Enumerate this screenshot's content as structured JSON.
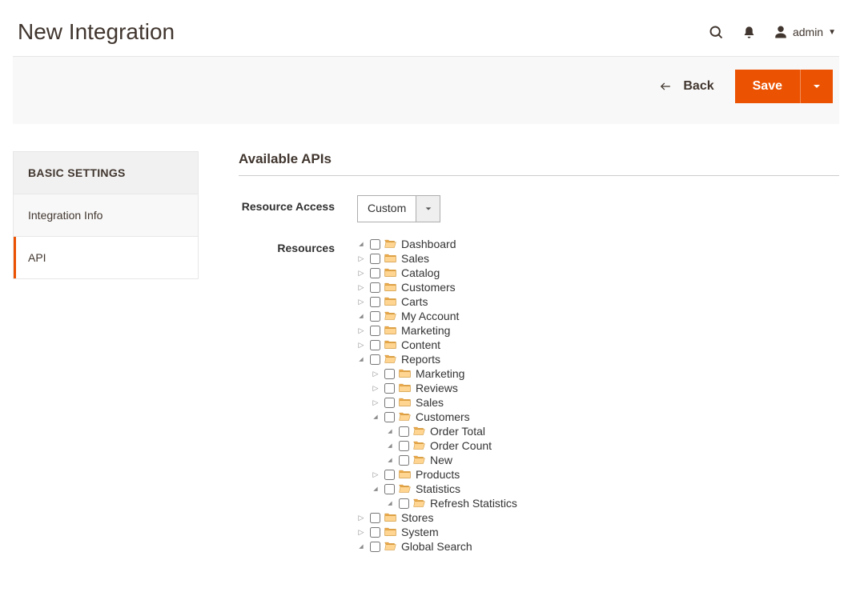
{
  "header": {
    "title": "New Integration",
    "username": "admin"
  },
  "toolbar": {
    "back_label": "Back",
    "save_label": "Save"
  },
  "sidebar": {
    "title": "BASIC SETTINGS",
    "items": [
      {
        "label": "Integration Info",
        "active": false
      },
      {
        "label": "API",
        "active": true
      }
    ]
  },
  "main": {
    "section_title": "Available APIs",
    "resource_access_label": "Resource Access",
    "resource_access_value": "Custom",
    "resources_label": "Resources",
    "tree": [
      {
        "label": "Dashboard",
        "expand": "open",
        "children": []
      },
      {
        "label": "Sales",
        "expand": "closed"
      },
      {
        "label": "Catalog",
        "expand": "closed"
      },
      {
        "label": "Customers",
        "expand": "closed"
      },
      {
        "label": "Carts",
        "expand": "closed"
      },
      {
        "label": "My Account",
        "expand": "open",
        "children": []
      },
      {
        "label": "Marketing",
        "expand": "closed"
      },
      {
        "label": "Content",
        "expand": "closed"
      },
      {
        "label": "Reports",
        "expand": "open",
        "children": [
          {
            "label": "Marketing",
            "expand": "closed"
          },
          {
            "label": "Reviews",
            "expand": "closed"
          },
          {
            "label": "Sales",
            "expand": "closed"
          },
          {
            "label": "Customers",
            "expand": "open",
            "children": [
              {
                "label": "Order Total",
                "expand": "open",
                "children": []
              },
              {
                "label": "Order Count",
                "expand": "open",
                "children": []
              },
              {
                "label": "New",
                "expand": "open",
                "children": []
              }
            ]
          },
          {
            "label": "Products",
            "expand": "closed"
          },
          {
            "label": "Statistics",
            "expand": "open",
            "children": [
              {
                "label": "Refresh Statistics",
                "expand": "open",
                "children": []
              }
            ]
          }
        ]
      },
      {
        "label": "Stores",
        "expand": "closed"
      },
      {
        "label": "System",
        "expand": "closed"
      },
      {
        "label": "Global Search",
        "expand": "open",
        "children": []
      }
    ]
  }
}
